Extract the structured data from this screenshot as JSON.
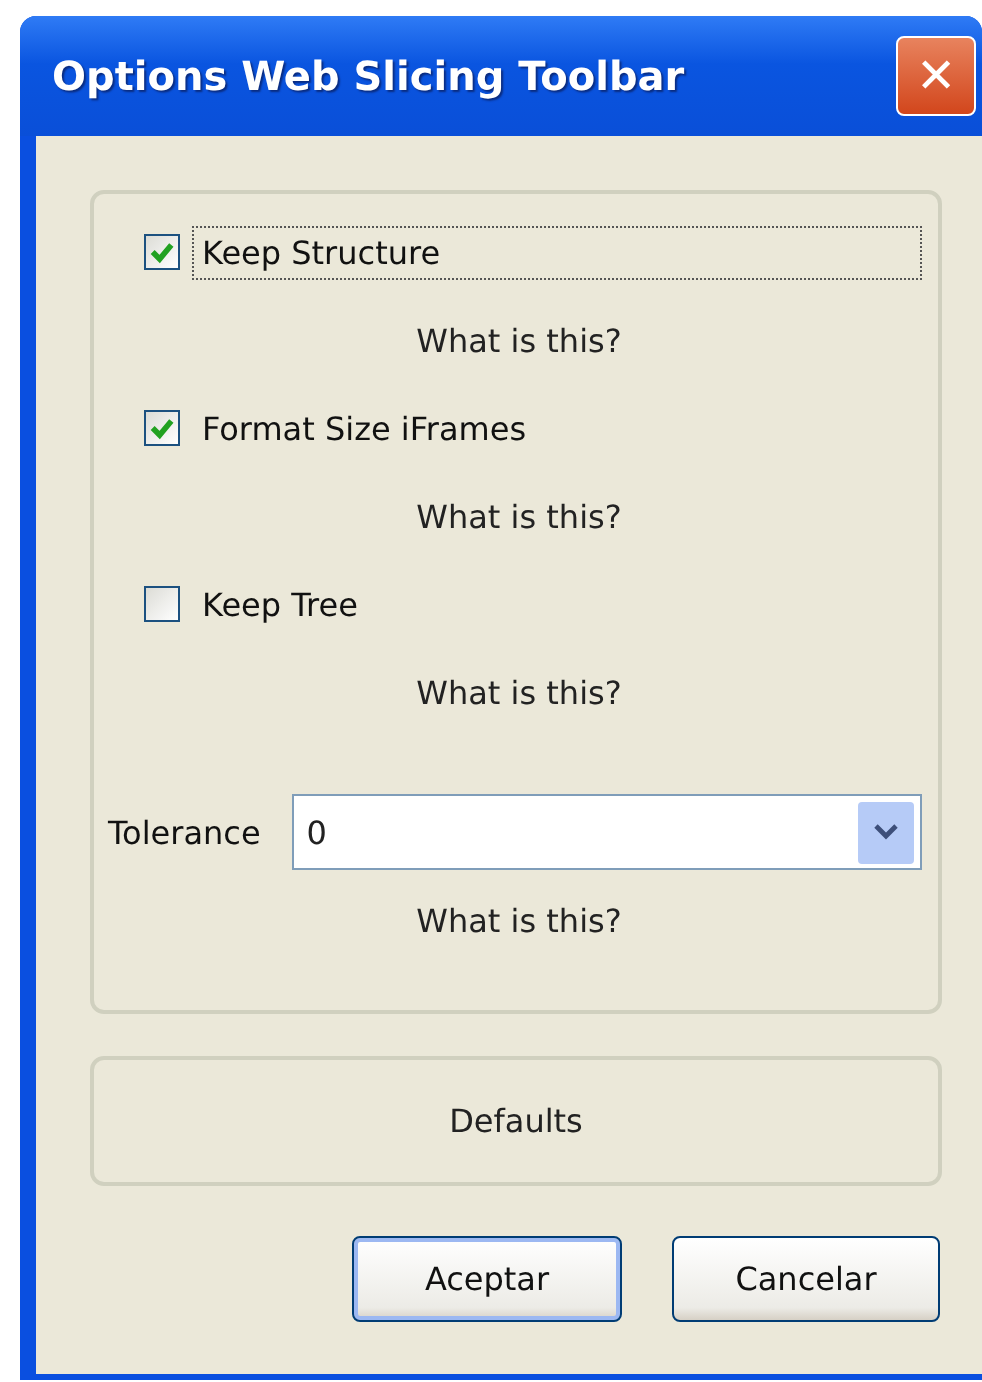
{
  "window": {
    "title": "Options Web Slicing Toolbar",
    "close": "✕"
  },
  "options": [
    {
      "label": "Keep Structure",
      "checked": true,
      "focused": true,
      "help": "What is this?"
    },
    {
      "label": "Format Size iFrames",
      "checked": true,
      "focused": false,
      "help": "What is this?"
    },
    {
      "label": "Keep Tree",
      "checked": false,
      "focused": false,
      "help": "What is this?"
    }
  ],
  "tolerance": {
    "label": "Tolerance",
    "value": "0",
    "help": "What is this?"
  },
  "defaults_button": "Defaults",
  "buttons": [
    {
      "label": "Aceptar",
      "default": true
    },
    {
      "label": "Cancelar",
      "default": false
    }
  ]
}
